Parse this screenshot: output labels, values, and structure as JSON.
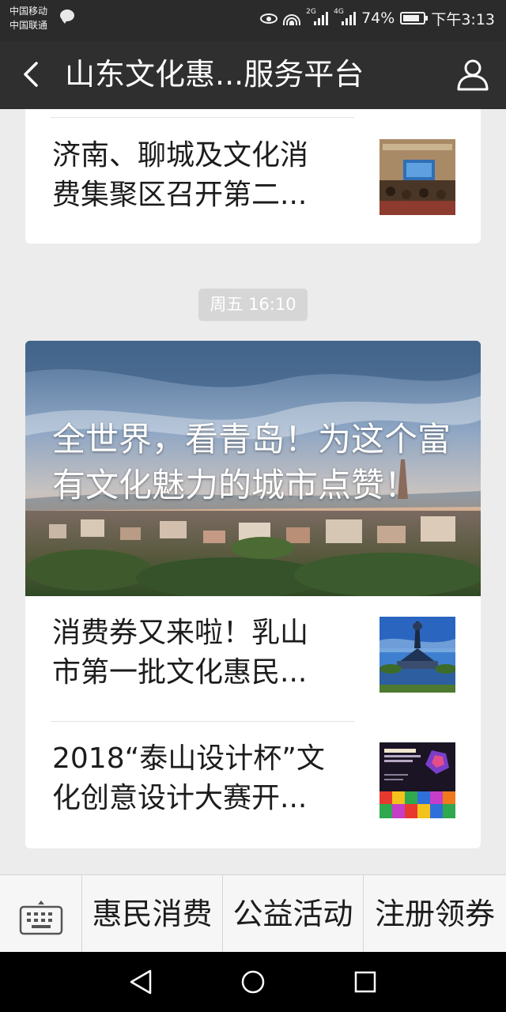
{
  "status_bar": {
    "carrier_1": "中国移动",
    "carrier_2": "中国联通",
    "net_1": "2G",
    "net_2": "4G",
    "battery": "74%",
    "time": "下午3:13"
  },
  "nav": {
    "title": "山东文化惠...服务平台",
    "back_icon": "chevron-left-icon",
    "profile_icon": "user-icon"
  },
  "messages": [
    {
      "items": [
        {
          "title_line1": "济南、聊城及文化消",
          "title_line2": "费集聚区召开第二...",
          "thumb_icon": "meeting-photo"
        }
      ]
    },
    {
      "time": "周五 16:10",
      "hero_title": "全世界，看青岛！为这个富有文化魅力的城市点赞！",
      "items": [
        {
          "title_line1": "消费券又来啦！乳山",
          "title_line2": "市第一批文化惠民...",
          "thumb_icon": "monument-photo"
        },
        {
          "title_line1": "2018“泰山设计杯”文",
          "title_line2": "化创意设计大赛开...",
          "thumb_icon": "poster-photo"
        }
      ]
    }
  ],
  "menu": {
    "keyboard_icon": "keyboard-icon",
    "items": [
      "惠民消费",
      "公益活动",
      "注册领券"
    ]
  },
  "system_nav": [
    "back-triangle-icon",
    "home-circle-icon",
    "recents-square-icon"
  ],
  "colors": {
    "status_bar": "#2b2b2b",
    "nav_bar": "#2f2f2f",
    "background": "#ececec",
    "card": "#ffffff",
    "time_badge": "#d6d6d6"
  }
}
